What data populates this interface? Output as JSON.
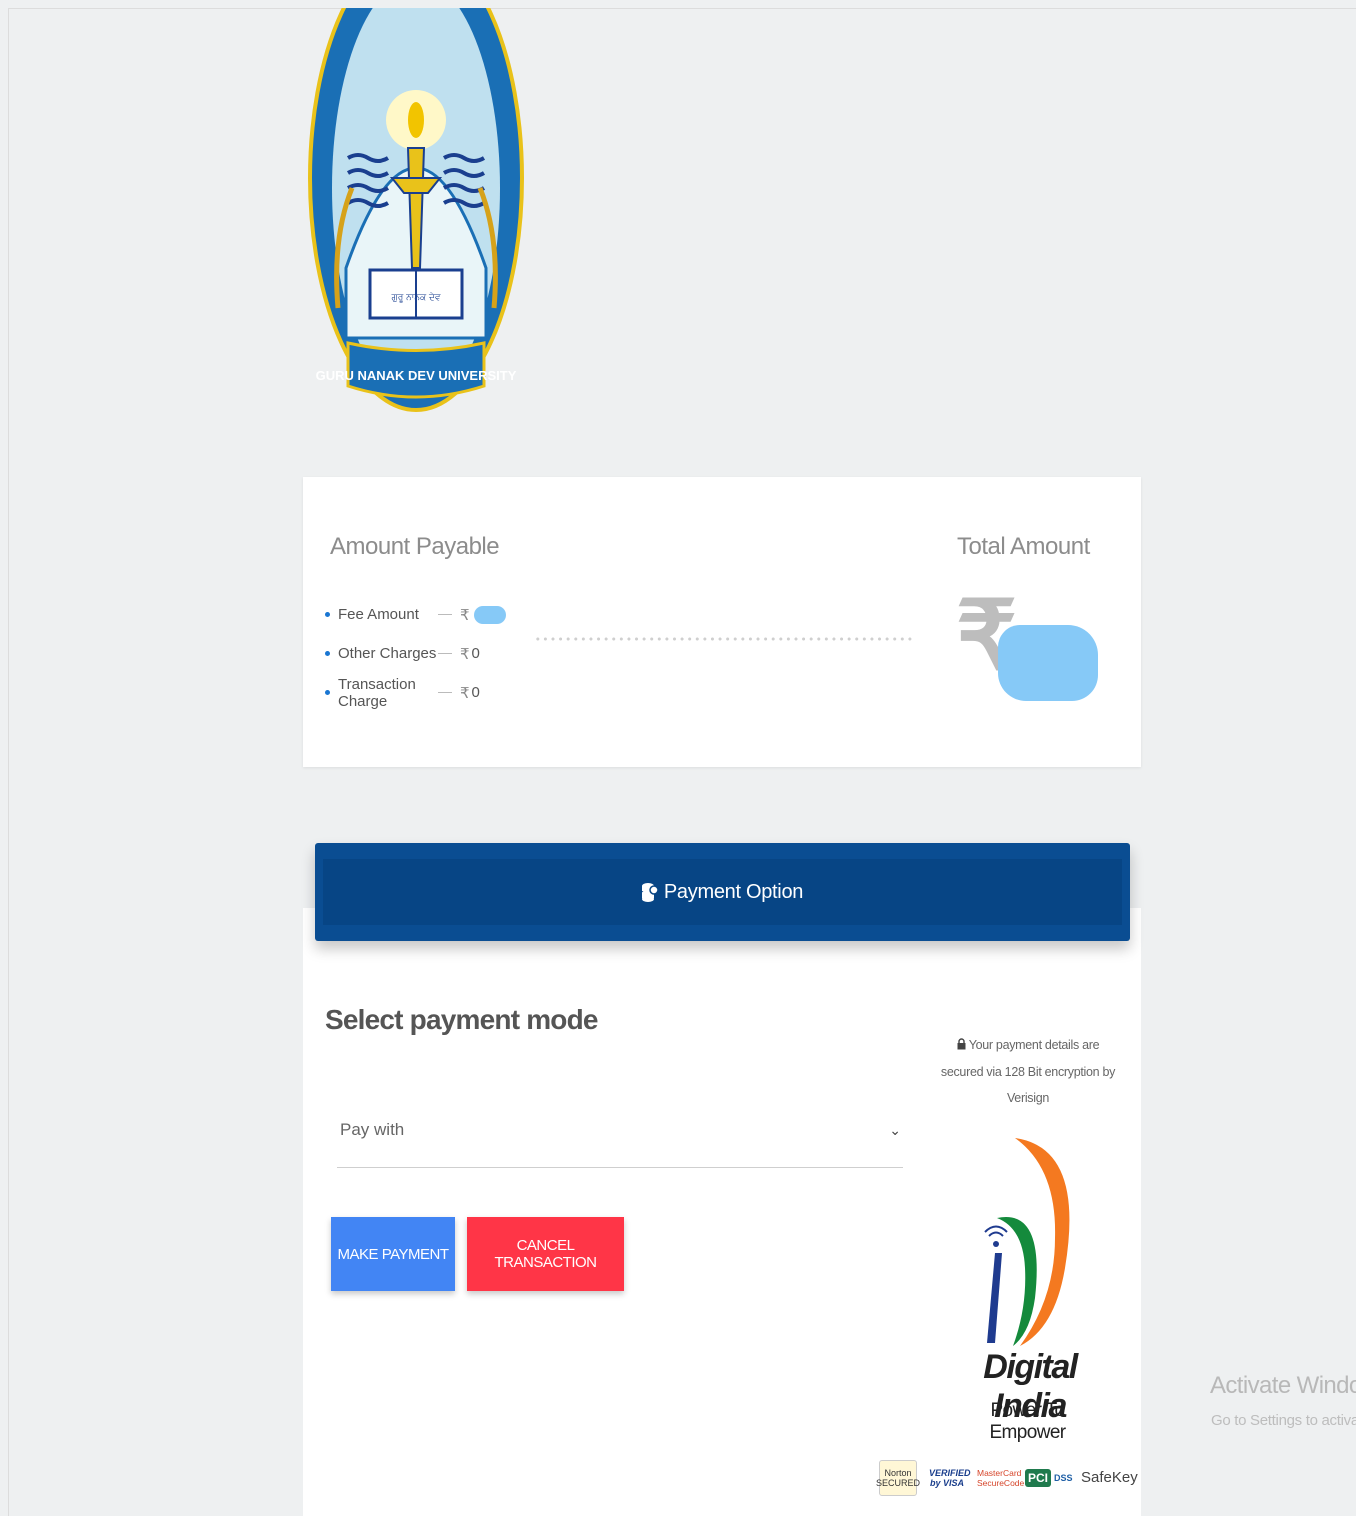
{
  "logo": {
    "name": "GURU NANAK DEV UNIVERSITY"
  },
  "amount_card": {
    "title": "Amount Payable",
    "currency_symbol": "₹",
    "items": [
      {
        "label": "Fee Amount",
        "value": ""
      },
      {
        "label": "Other Charges",
        "value": "0"
      },
      {
        "label": "Transaction Charge",
        "value": "0"
      }
    ],
    "total_title": "Total Amount",
    "total_value": ""
  },
  "payment": {
    "header_label": "Payment Option",
    "section_title": "Select payment mode",
    "select_placeholder": "Pay with",
    "make_payment_label": "MAKE PAYMENT",
    "cancel_label": "CANCEL TRANSACTION",
    "secure_note": "Your payment details are secured via 128 Bit encryption by Verisign"
  },
  "digital_india": {
    "title": "Digital India",
    "tagline": "Power To Empower"
  },
  "badges": {
    "norton": "Norton SECURED",
    "visa": "VERIFIED by VISA",
    "mastercard": "MasterCard SecureCode",
    "pci": "PCI",
    "dss": "DSS",
    "safekey": "SafeKey"
  },
  "windows_watermark": {
    "title": "Activate Windows",
    "subtitle": "Go to Settings to activate Wi"
  },
  "colors": {
    "header_blue": "#074585",
    "make_payment": "#4285f4",
    "cancel": "#ff3547",
    "redaction": "#86c9f7"
  },
  "icons": [
    "coins-icon",
    "lock-icon",
    "chevron-down-icon",
    "bullet-icon"
  ]
}
